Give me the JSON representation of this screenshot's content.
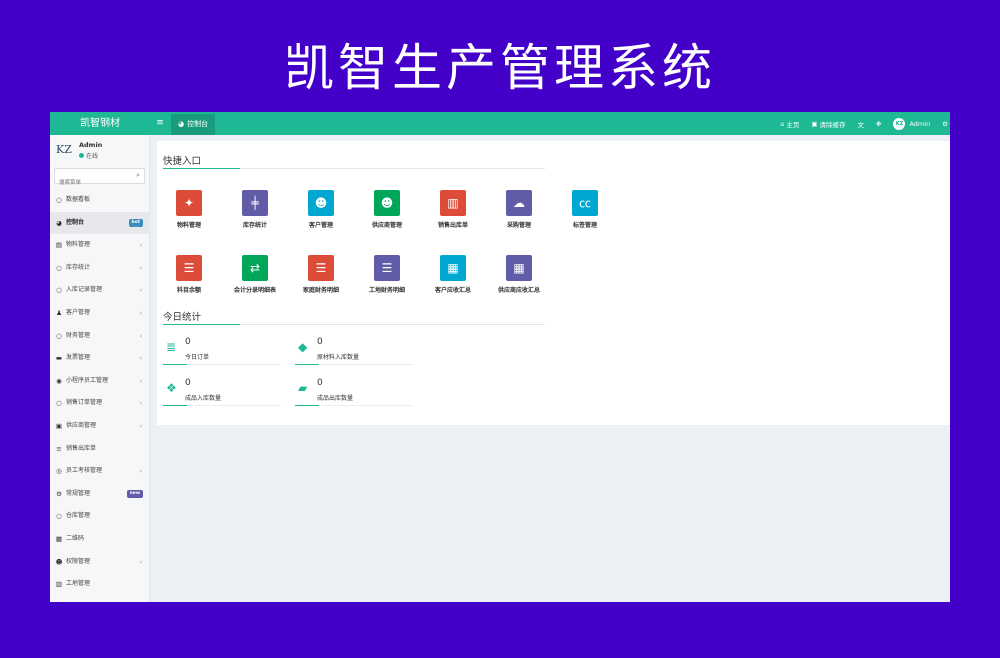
{
  "hero": {
    "title": "凯智生产管理系统"
  },
  "topbar": {
    "brand": "凯智钢材",
    "tab": "控制台",
    "home": "主页",
    "clear_cache": "清除缓存",
    "user": "Admin",
    "avatar": "KZ"
  },
  "sidebar": {
    "logo": "KZ",
    "user_name": "Admin",
    "status": "在线",
    "search_placeholder": "搜索菜单",
    "items": [
      {
        "label": "数据看板",
        "icon": "circle-icon"
      },
      {
        "label": "控制台",
        "icon": "dashboard-icon",
        "badge": "hot",
        "active": true
      },
      {
        "label": "物料管理",
        "icon": "box-icon"
      },
      {
        "label": "库存统计",
        "icon": "circle-icon"
      },
      {
        "label": "入库记录管理",
        "icon": "circle-icon"
      },
      {
        "label": "客户管理",
        "icon": "user-icon"
      },
      {
        "label": "财务管理",
        "icon": "circle-icon"
      },
      {
        "label": "发票管理",
        "icon": "card-icon"
      },
      {
        "label": "小程序员工管理",
        "icon": "person-circle-icon"
      },
      {
        "label": "销售订单管理",
        "icon": "circle-icon"
      },
      {
        "label": "供应商管理",
        "icon": "id-card-icon"
      },
      {
        "label": "销售出库单",
        "icon": "list-icon"
      },
      {
        "label": "员工考核管理",
        "icon": "target-icon"
      },
      {
        "label": "常规管理",
        "icon": "cogs-icon",
        "badge": "new"
      },
      {
        "label": "仓库管理",
        "icon": "circle-icon"
      },
      {
        "label": "二维码",
        "icon": "qrcode-icon"
      },
      {
        "label": "权限管理",
        "icon": "group-icon"
      },
      {
        "label": "工地管理",
        "icon": "building-icon"
      }
    ]
  },
  "quick": {
    "title": "快捷入口",
    "tiles": [
      {
        "label": "物料管理",
        "color": "#dd4b39",
        "icon": "magic-icon",
        "glyph": "✦"
      },
      {
        "label": "库存统计",
        "color": "#605ca8",
        "icon": "signpost-icon",
        "glyph": "╪"
      },
      {
        "label": "客户管理",
        "color": "#00a7d0",
        "icon": "users-icon",
        "glyph": "☻"
      },
      {
        "label": "供应商管理",
        "color": "#00a65a",
        "icon": "users-icon",
        "glyph": "☻"
      },
      {
        "label": "销售出库单",
        "color": "#dd4b39",
        "icon": "map-icon",
        "glyph": "▥"
      },
      {
        "label": "采购管理",
        "color": "#605ca8",
        "icon": "cloud-icon",
        "glyph": "☁"
      },
      {
        "label": "标签管理",
        "color": "#00a7d0",
        "icon": "cc-icon",
        "glyph": "㏄"
      },
      {
        "label": "科目余额",
        "color": "#dd4b39",
        "icon": "list-alt-icon",
        "glyph": "☰"
      },
      {
        "label": "会计分录明细表",
        "color": "#00a65a",
        "icon": "exchange-icon",
        "glyph": "⇄"
      },
      {
        "label": "家庭财务明细",
        "color": "#dd4b39",
        "icon": "indent-icon",
        "glyph": "☰"
      },
      {
        "label": "工地财务明细",
        "color": "#605ca8",
        "icon": "indent-icon",
        "glyph": "☰"
      },
      {
        "label": "客户应收汇总",
        "color": "#00a7d0",
        "icon": "calculator-icon",
        "glyph": "▦"
      },
      {
        "label": "供应商应收汇总",
        "color": "#605ca8",
        "icon": "calculator-icon",
        "glyph": "▦"
      }
    ]
  },
  "today": {
    "title": "今日统计",
    "stats": [
      {
        "value": "0",
        "label": "今日订单",
        "icon": "database-icon",
        "glyph": "≣"
      },
      {
        "value": "0",
        "label": "原材料入库数量",
        "icon": "cube-icon",
        "glyph": "◆"
      },
      {
        "value": "0",
        "label": "成品入库数量",
        "icon": "cubes-icon",
        "glyph": "❖"
      },
      {
        "value": "0",
        "label": "成品出库数量",
        "icon": "truck-icon",
        "glyph": "▰"
      }
    ]
  }
}
